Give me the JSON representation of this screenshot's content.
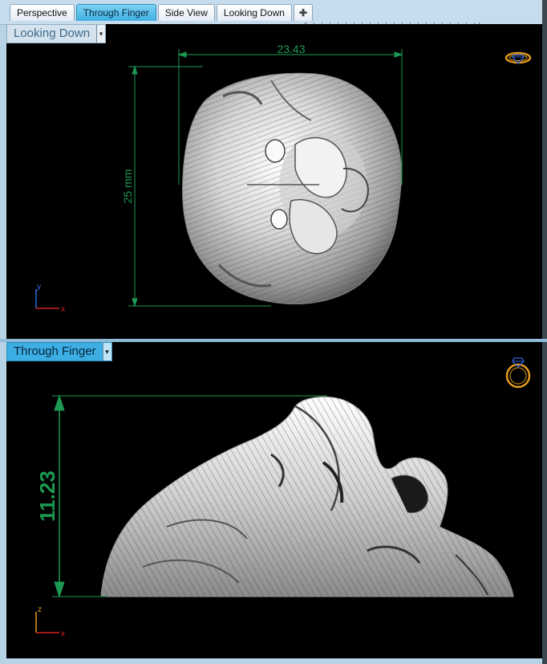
{
  "tabs": [
    {
      "label": "Perspective",
      "active": false
    },
    {
      "label": "Through Finger",
      "active": true
    },
    {
      "label": "Side View",
      "active": false
    },
    {
      "label": "Looking Down",
      "active": false
    },
    {
      "label": "✚",
      "active": false
    }
  ],
  "viewports": {
    "top": {
      "label": "Looking Down",
      "dim_width": "23.43",
      "dim_height": "25 mm",
      "axis_y": "y",
      "axis_x": "x"
    },
    "bottom": {
      "label": "Through Finger",
      "dim_height": "11.23",
      "axis_z": "z",
      "axis_x": "x"
    }
  },
  "icons": {
    "dropdown": "▾",
    "ring_top": "ring-top-view-icon",
    "ring_front": "ring-front-view-icon"
  },
  "colors": {
    "dimension": "#1c9a52",
    "ring_gold": "#e39b1c",
    "gem_blue": "#2f5fd6",
    "axis_x": "#d42020",
    "axis_y": "#2a6fe0"
  }
}
